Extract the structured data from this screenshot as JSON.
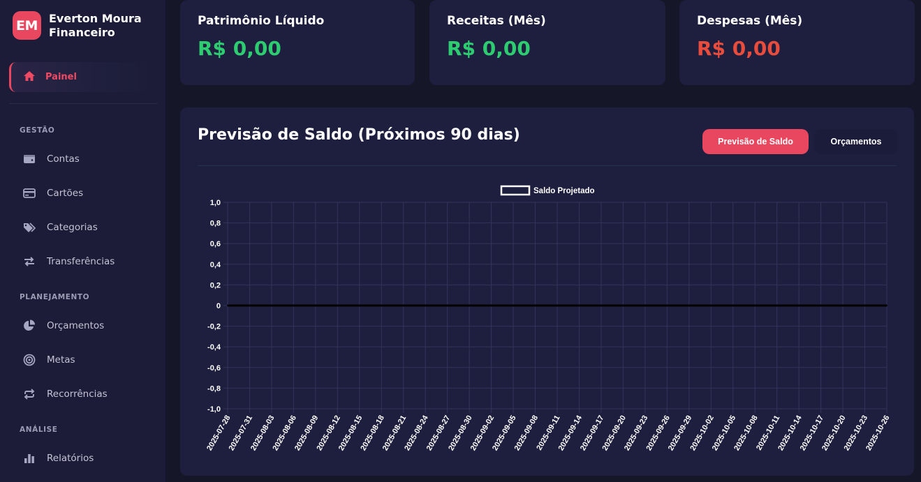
{
  "brand": {
    "logo": "EM",
    "name": "Everton Moura Financeiro"
  },
  "sidebar": {
    "active": {
      "label": "Painel",
      "icon": "home-icon"
    },
    "sections": [
      {
        "title": "GESTÃO",
        "items": [
          {
            "label": "Contas",
            "icon": "wallet-icon"
          },
          {
            "label": "Cartões",
            "icon": "credit-card-icon"
          },
          {
            "label": "Categorias",
            "icon": "tags-icon"
          },
          {
            "label": "Transferências",
            "icon": "exchange-icon"
          }
        ]
      },
      {
        "title": "PLANEJAMENTO",
        "items": [
          {
            "label": "Orçamentos",
            "icon": "pie-chart-icon"
          },
          {
            "label": "Metas",
            "icon": "target-icon"
          },
          {
            "label": "Recorrências",
            "icon": "recurring-icon"
          }
        ]
      },
      {
        "title": "ANÁLISE",
        "items": [
          {
            "label": "Relatórios",
            "icon": "bar-chart-icon"
          }
        ]
      }
    ]
  },
  "stats": [
    {
      "title": "Patrimônio Líquido",
      "value": "R$ 0,00",
      "color": "#2ecc71"
    },
    {
      "title": "Receitas (Mês)",
      "value": "R$ 0,00",
      "color": "#2ecc71"
    },
    {
      "title": "Despesas (Mês)",
      "value": "R$ 0,00",
      "color": "#e74c3c"
    }
  ],
  "chart_panel": {
    "title": "Previsão de Saldo (Próximos 90 dias)",
    "tab_active": "Previsão de Saldo",
    "tab_other": "Orçamentos"
  },
  "colors": {
    "accent": "#e8475f",
    "positive": "#2ecc71",
    "negative": "#e74c3c",
    "panel": "#1e1e3f",
    "background": "#161629"
  },
  "chart_data": {
    "type": "line",
    "legend": [
      "Saldo Projetado"
    ],
    "legend_position": "top-center",
    "grid": true,
    "ylim": [
      -1,
      1
    ],
    "y_ticks": [
      "1,0",
      "0,8",
      "0,6",
      "0,4",
      "0,2",
      "0",
      "-0,2",
      "-0,4",
      "-0,6",
      "-0,8",
      "-1,0"
    ],
    "x": [
      "2025-07-28",
      "2025-07-31",
      "2025-08-03",
      "2025-08-06",
      "2025-08-09",
      "2025-08-12",
      "2025-08-15",
      "2025-08-18",
      "2025-08-21",
      "2025-08-24",
      "2025-08-27",
      "2025-08-30",
      "2025-09-02",
      "2025-09-05",
      "2025-09-08",
      "2025-09-11",
      "2025-09-14",
      "2025-09-17",
      "2025-09-20",
      "2025-09-23",
      "2025-09-26",
      "2025-09-29",
      "2025-10-02",
      "2025-10-05",
      "2025-10-08",
      "2025-10-11",
      "2025-10-14",
      "2025-10-17",
      "2025-10-20",
      "2025-10-23",
      "2025-10-26"
    ],
    "series": [
      {
        "name": "Saldo Projetado",
        "values": [
          0,
          0,
          0,
          0,
          0,
          0,
          0,
          0,
          0,
          0,
          0,
          0,
          0,
          0,
          0,
          0,
          0,
          0,
          0,
          0,
          0,
          0,
          0,
          0,
          0,
          0,
          0,
          0,
          0,
          0,
          0
        ]
      }
    ]
  }
}
